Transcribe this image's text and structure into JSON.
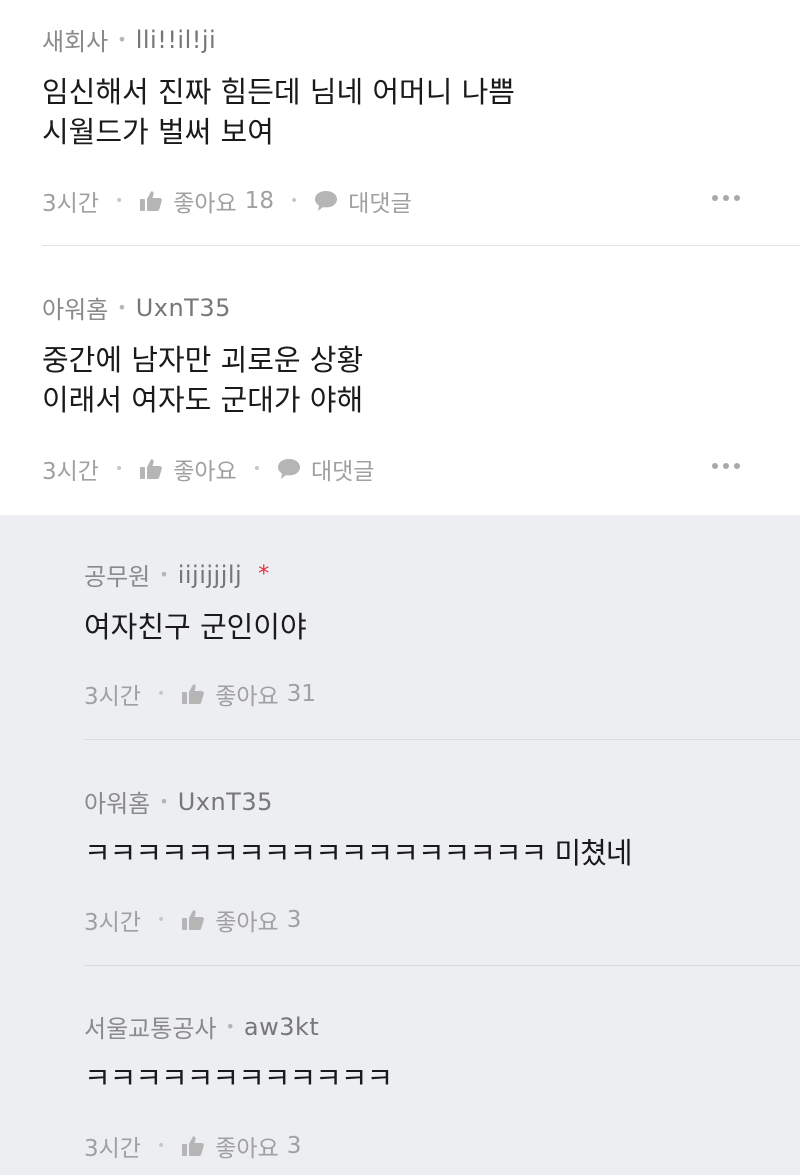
{
  "comments": [
    {
      "company": "새회사",
      "nickname": "lli!!il!ji",
      "text": "임신해서 진짜 힘든데 님네 어머니 나쁨\n시월드가 벌써 보여",
      "time": "3시간",
      "like_label": "좋아요",
      "like_count": "18",
      "reply_label": "대댓글"
    },
    {
      "company": "아워홈",
      "nickname": "UxnT35",
      "text": "중간에 남자만 괴로운 상황\n이래서 여자도 군대가 야해",
      "time": "3시간",
      "like_label": "좋아요",
      "like_count": "",
      "reply_label": "대댓글"
    }
  ],
  "replies": [
    {
      "company": "공무원",
      "nickname": "iijijjjlj",
      "marker": "*",
      "text": "여자친구 군인이야",
      "time": "3시간",
      "like_label": "좋아요",
      "like_count": "31"
    },
    {
      "company": "아워홈",
      "nickname": "UxnT35",
      "text": "ㅋㅋㅋㅋㅋㅋㅋㅋㅋㅋㅋㅋㅋㅋㅋㅋㅋㅋ 미쳤네",
      "time": "3시간",
      "like_label": "좋아요",
      "like_count": "3"
    },
    {
      "company": "서울교통공사",
      "nickname": "aw3kt",
      "text": "ㅋㅋㅋㅋㅋㅋㅋㅋㅋㅋㅋㅋ",
      "time": "3시간",
      "like_label": "좋아요",
      "like_count": "3"
    }
  ],
  "colors": {
    "reply_background": "#eceef2",
    "new_reply_marker": "#e0313c",
    "meta_text": "#8d8d8d"
  },
  "icons": {
    "like": "thumbs-up-icon",
    "reply": "speech-bubble-icon",
    "more": "more-dots-icon"
  }
}
